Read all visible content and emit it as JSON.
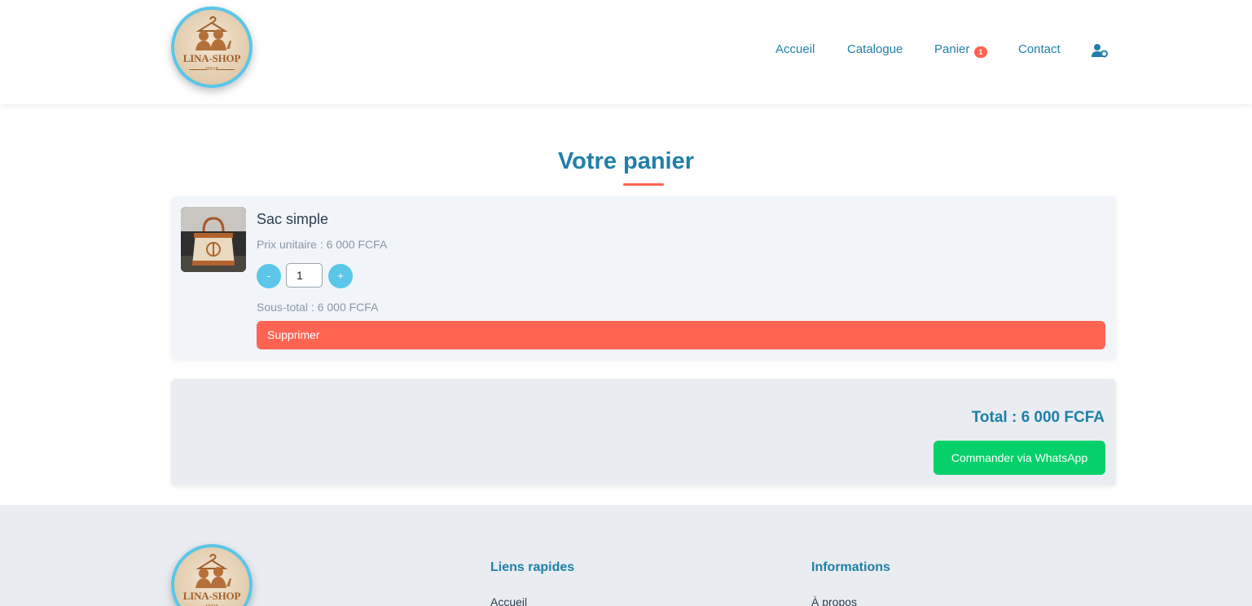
{
  "brand": {
    "name": "LINA-SHOP",
    "tagline": "SHOP"
  },
  "nav": {
    "items": [
      {
        "label": "Accueil"
      },
      {
        "label": "Catalogue"
      },
      {
        "label": "Panier",
        "badge": "1"
      },
      {
        "label": "Contact"
      }
    ],
    "account_icon": "user-cog-icon"
  },
  "main": {
    "title": "Votre panier"
  },
  "cart": {
    "items": [
      {
        "name": "Sac simple",
        "unit_price": "Prix unitaire : 6 000 FCFA",
        "quantity": "1",
        "minus_label": "-",
        "plus_label": "+",
        "subtotal": "Sous-total : 6 000 FCFA",
        "delete_label": "Supprimer"
      }
    ]
  },
  "summary": {
    "total": "Total : 6 000 FCFA",
    "order_label": "Commander via WhatsApp"
  },
  "footer": {
    "quick_links_title": "Liens rapides",
    "quick_links": [
      "Accueil"
    ],
    "info_title": "Informations",
    "info_links": [
      "À propos"
    ]
  },
  "colors": {
    "primary": "#1f7fa8",
    "accent": "#ff6450",
    "whatsapp": "#06d06a",
    "qty_button": "#5bc6e8"
  }
}
